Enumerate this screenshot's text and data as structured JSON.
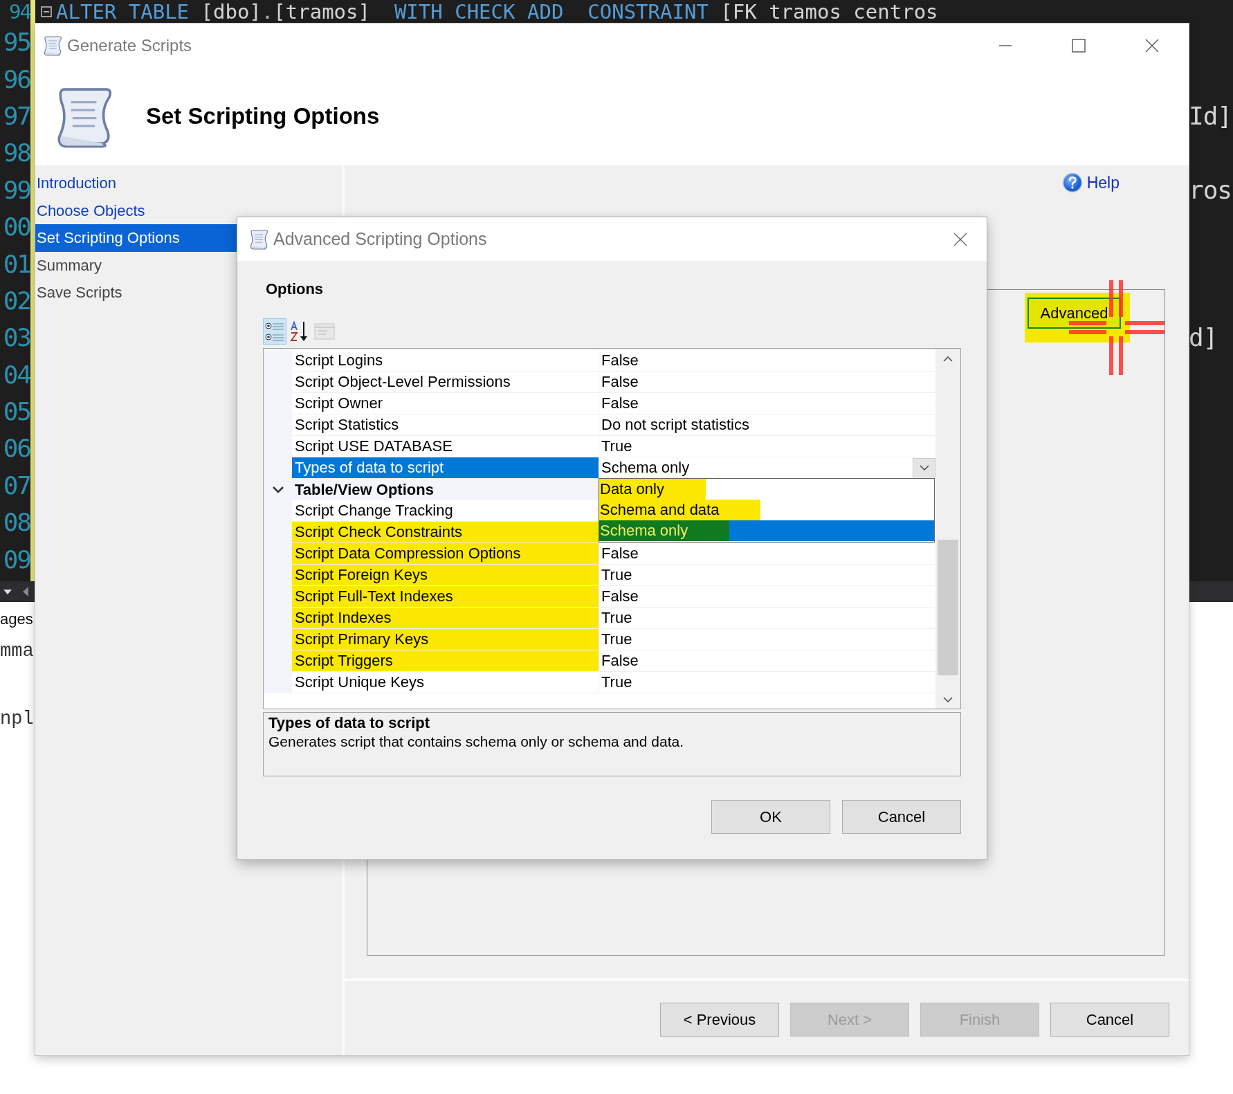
{
  "editor": {
    "lines": [
      {
        "number": "94",
        "code": [
          {
            "kind": "keyword",
            "text": "ALTER TABLE "
          },
          {
            "kind": "ident",
            "text": "[dbo]"
          },
          {
            "kind": "punct",
            "text": "."
          },
          {
            "kind": "ident",
            "text": "[tramos]"
          },
          {
            "kind": "keyword",
            "text": "  WITH CHECK ADD  CONSTRAINT "
          },
          {
            "kind": "ident",
            "text": "[FK_tramos_centros"
          }
        ]
      },
      {
        "number": "95"
      },
      {
        "number": "96"
      },
      {
        "number": "97",
        "tail": "Id]"
      },
      {
        "number": "98"
      },
      {
        "number": "99",
        "tail": "ros"
      },
      {
        "number": "00"
      },
      {
        "number": "01"
      },
      {
        "number": "02"
      },
      {
        "number": "03",
        "tail": "d]"
      },
      {
        "number": "04"
      },
      {
        "number": "05"
      },
      {
        "number": "06"
      },
      {
        "number": "07"
      },
      {
        "number": "08"
      },
      {
        "number": "09"
      }
    ]
  },
  "output_pane": {
    "lines": [
      {
        "kind": "tab",
        "text": "ages"
      },
      {
        "kind": "text",
        "text": "mma"
      },
      {
        "kind": "text",
        "text": "npl"
      }
    ]
  },
  "generate_window": {
    "title": "Generate Scripts",
    "header_title": "Set Scripting Options",
    "nav": [
      {
        "label": "Introduction",
        "selected": false,
        "visited": true
      },
      {
        "label": "Choose Objects",
        "selected": false,
        "visited": true
      },
      {
        "label": "Set Scripting Options",
        "selected": true,
        "visited": true
      },
      {
        "label": "Summary",
        "selected": false,
        "visited": false
      },
      {
        "label": "Save Scripts",
        "selected": false,
        "visited": false
      }
    ],
    "help_link": "Help",
    "advanced_button": {
      "label": "Advanced",
      "highlighted": true
    },
    "buttons": [
      {
        "label": "< Previous",
        "disabled": false
      },
      {
        "label": "Next >",
        "disabled": true
      },
      {
        "label": "Finish",
        "disabled": true
      },
      {
        "label": "Cancel",
        "disabled": false
      }
    ]
  },
  "advanced_dialog": {
    "title": "Advanced Scripting Options",
    "section": "Options",
    "toolbar": [
      {
        "kind": "categorized",
        "selected": true,
        "disabled": false
      },
      {
        "kind": "alphabetical",
        "selected": false,
        "disabled": false
      },
      {
        "kind": "pages",
        "selected": false,
        "disabled": true
      }
    ],
    "rows": [
      {
        "kind": "property",
        "name": "Script Logins",
        "value": "False",
        "selected": false,
        "highlighted": false
      },
      {
        "kind": "property",
        "name": "Script Object-Level Permissions",
        "value": "False",
        "selected": false,
        "highlighted": false
      },
      {
        "kind": "property",
        "name": "Script Owner",
        "value": "False",
        "selected": false,
        "highlighted": false
      },
      {
        "kind": "property",
        "name": "Script Statistics",
        "value": "Do not script statistics",
        "selected": false,
        "highlighted": false
      },
      {
        "kind": "property",
        "name": "Script USE DATABASE",
        "value": "True",
        "selected": false,
        "highlighted": false
      },
      {
        "kind": "property",
        "name": "Types of data to script",
        "value": "Schema only",
        "selected": true,
        "highlighted": false
      },
      {
        "kind": "category",
        "name": "Table/View Options",
        "expanded": true
      },
      {
        "kind": "property",
        "name": "Script Change Tracking",
        "selected": false,
        "highlighted": false
      },
      {
        "kind": "property",
        "name": "Script Check Constraints",
        "selected": false,
        "highlighted": true
      },
      {
        "kind": "property",
        "name": "Script Data Compression Options",
        "value": "False",
        "selected": false,
        "highlighted": true
      },
      {
        "kind": "property",
        "name": "Script Foreign Keys",
        "value": "True",
        "selected": false,
        "highlighted": true
      },
      {
        "kind": "property",
        "name": "Script Full-Text Indexes",
        "value": "False",
        "selected": false,
        "highlighted": true
      },
      {
        "kind": "property",
        "name": "Script Indexes",
        "value": "True",
        "selected": false,
        "highlighted": true
      },
      {
        "kind": "property",
        "name": "Script Primary Keys",
        "value": "True",
        "selected": false,
        "highlighted": true
      },
      {
        "kind": "property",
        "name": "Script Triggers",
        "value": "False",
        "selected": false,
        "highlighted": true
      },
      {
        "kind": "property",
        "name": "Script Unique Keys",
        "value": "True",
        "selected": false,
        "highlighted": false
      }
    ],
    "dropdown": {
      "options": [
        {
          "label": "Data only",
          "selected": false,
          "highlighted": true
        },
        {
          "label": "Schema and data",
          "selected": false,
          "highlighted": true
        },
        {
          "label": "Schema only",
          "selected": true,
          "highlighted": true
        }
      ]
    },
    "description": {
      "title": "Types of data to script",
      "text": "Generates script that contains schema only or schema and data."
    },
    "buttons": [
      {
        "label": "OK"
      },
      {
        "label": "Cancel"
      }
    ]
  }
}
